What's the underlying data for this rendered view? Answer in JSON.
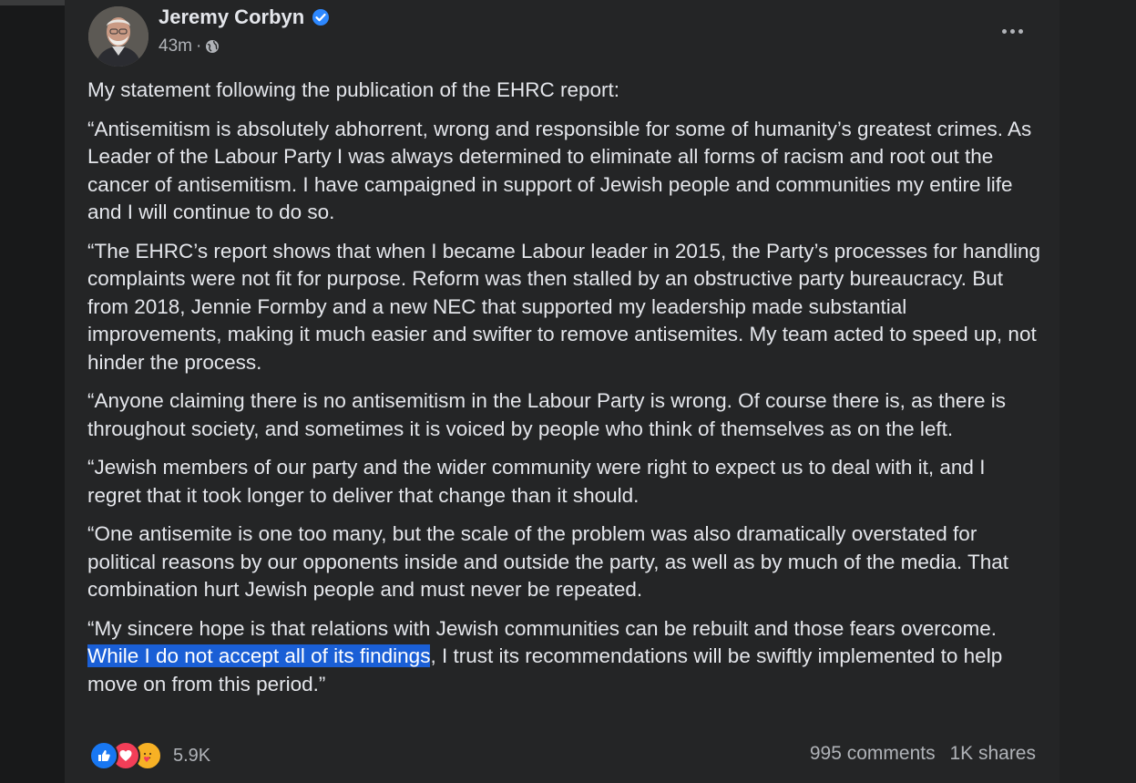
{
  "post": {
    "author": "Jeremy Corbyn",
    "time": "43m",
    "separator": "·",
    "paragraphs": {
      "p0": "My statement following the publication of the EHRC report:",
      "p1": "“Antisemitism is absolutely abhorrent, wrong and responsible for some of humanity’s greatest crimes. As Leader of the Labour Party I was always determined to eliminate all forms of racism and root out the cancer of antisemitism. I have campaigned in support of Jewish people and communities my entire life and I will continue to do so.",
      "p2": "“The EHRC’s report shows that when I became Labour leader in 2015, the Party’s processes for handling complaints were not fit for purpose. Reform was then stalled by an obstructive party bureaucracy. But from 2018, Jennie Formby and a new NEC that supported my leadership made substantial improvements, making it much easier and swifter to remove antisemites. My team acted to speed up, not hinder the process.",
      "p3": "“Anyone claiming there is no antisemitism in the Labour Party is wrong. Of course there is, as there is throughout society, and sometimes it is voiced by people who think of themselves as on the left.",
      "p4": "“Jewish members of our party and the wider community were right to expect us to deal with it, and I regret that it took longer to deliver that change than it should.",
      "p5": "“One antisemite is one too many,  but the scale of the problem was also dramatically overstated for political reasons by our opponents inside and outside the party, as well as by much of the media. That combination hurt Jewish people and must never be repeated.",
      "p6_before": "“My sincere hope is that relations with Jewish communities can be rebuilt and those fears overcome. ",
      "p6_highlight": "While I do not accept all of its findings",
      "p6_after": ", I trust its recommendations will be swiftly implemented to help move on from this period.”"
    },
    "reactions": {
      "icons": [
        "like-icon",
        "love-icon",
        "care-icon"
      ],
      "count": "5.9K"
    },
    "comments": "995 comments",
    "shares": "1K shares"
  },
  "colors": {
    "background": "#18191a",
    "card": "#242526",
    "text": "#e4e6eb",
    "secondary_text": "#b0b3b8",
    "highlight": "#1a5fd6",
    "verified": "#2d88ff"
  }
}
